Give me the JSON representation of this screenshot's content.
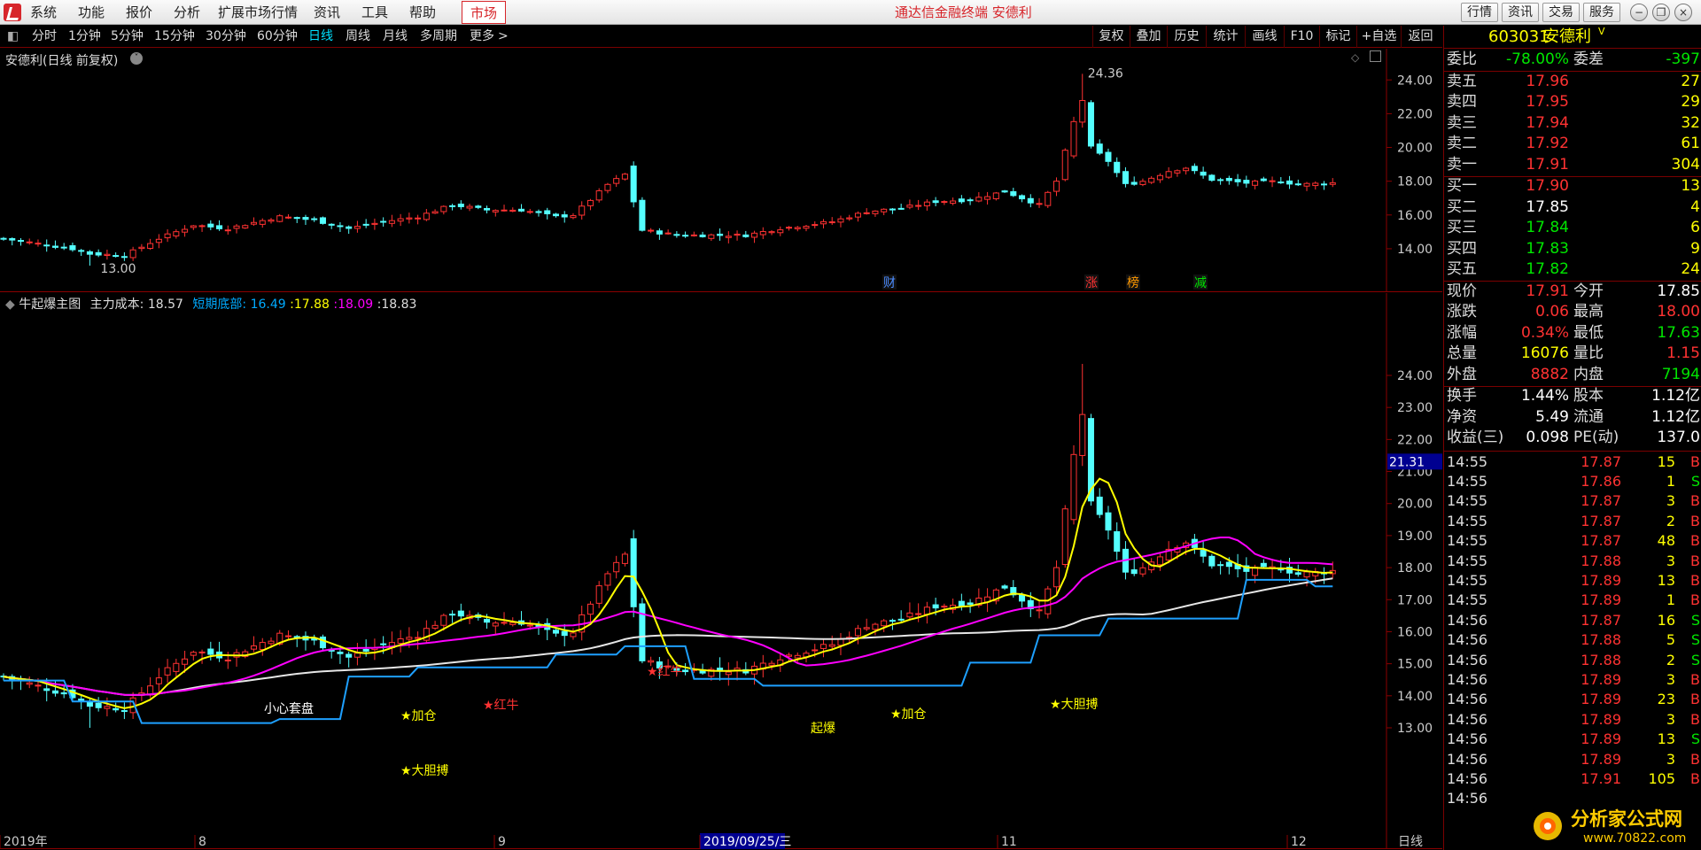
{
  "menu": {
    "items": [
      "系统",
      "功能",
      "报价",
      "分析",
      "扩展市场行情",
      "资讯",
      "工具",
      "帮助"
    ],
    "market_tab": "市场",
    "app_title": "通达信金融终端  安德利",
    "right_buttons": [
      "行情",
      "资讯",
      "交易",
      "服务"
    ]
  },
  "toolbar": {
    "periods": [
      "分时",
      "1分钟",
      "5分钟",
      "15分钟",
      "30分钟",
      "60分钟",
      "日线",
      "周线",
      "月线",
      "多周期",
      "更多"
    ],
    "active_period": "日线",
    "more_arrow": ">",
    "right": [
      "复权",
      "叠加",
      "历史",
      "统计",
      "画线",
      "F10",
      "标记",
      "+自选",
      "返回"
    ]
  },
  "top_chart": {
    "title": "安德利(日线 前复权)",
    "high_label": "24.36",
    "low_label": "13.00",
    "y_ticks": [
      "24.00",
      "22.00",
      "20.00",
      "18.00",
      "16.00",
      "14.00"
    ],
    "events": [
      {
        "label": "财",
        "color": "#4c8cff"
      },
      {
        "label": "涨",
        "color": "#ff3232"
      },
      {
        "label": "榜",
        "color": "#ff9900"
      },
      {
        "label": "减",
        "color": "#00e600"
      }
    ]
  },
  "main_chart": {
    "indicator": "牛起爆主图",
    "cost_label": "主力成本:",
    "cost_value": "18.57",
    "bottom_label": "短期底部:",
    "v1": "16.49",
    "v2": "17.88",
    "v3": "18.09",
    "v4": "18.83",
    "y_ticks": [
      "24.00",
      "23.00",
      "22.00",
      "21.00",
      "20.00",
      "19.00",
      "18.00",
      "17.00",
      "16.00",
      "15.00",
      "14.00",
      "13.00"
    ],
    "cursor_price": "21.31",
    "annotations": [
      "小心套盘",
      "★加仓",
      "★红牛",
      "★红牛",
      "★大胆搏",
      "★加仓",
      "★大胆搏",
      "起爆"
    ],
    "x_labels": [
      "2019年",
      "8",
      "9",
      "2019/09/25/三",
      "11",
      "12"
    ],
    "period_label": "日线"
  },
  "panel": {
    "code": "603031",
    "name": "安德利",
    "badge": "V",
    "weibi": {
      "l": "委比",
      "v": "-78.00%",
      "l2": "委差",
      "v2": "-397"
    },
    "sells": [
      {
        "l": "卖五",
        "p": "17.96",
        "v": "27"
      },
      {
        "l": "卖四",
        "p": "17.95",
        "v": "29"
      },
      {
        "l": "卖三",
        "p": "17.94",
        "v": "32"
      },
      {
        "l": "卖二",
        "p": "17.92",
        "v": "61"
      },
      {
        "l": "卖一",
        "p": "17.91",
        "v": "304"
      }
    ],
    "buys": [
      {
        "l": "买一",
        "p": "17.90",
        "v": "13"
      },
      {
        "l": "买二",
        "p": "17.85",
        "v": "4"
      },
      {
        "l": "买三",
        "p": "17.84",
        "v": "6"
      },
      {
        "l": "买四",
        "p": "17.83",
        "v": "9"
      },
      {
        "l": "买五",
        "p": "17.82",
        "v": "24"
      }
    ],
    "stats": [
      {
        "l": "现价",
        "v": "17.91",
        "l2": "今开",
        "v2": "17.85"
      },
      {
        "l": "涨跌",
        "v": "0.06",
        "l2": "最高",
        "v2": "18.00"
      },
      {
        "l": "涨幅",
        "v": "0.34%",
        "l2": "最低",
        "v2": "17.63"
      },
      {
        "l": "总量",
        "v": "16076",
        "l2": "量比",
        "v2": "1.15"
      },
      {
        "l": "外盘",
        "v": "8882",
        "l2": "内盘",
        "v2": "7194"
      }
    ],
    "fund": [
      {
        "l": "换手",
        "v": "1.44%",
        "l2": "股本",
        "v2": "1.12亿"
      },
      {
        "l": "净资",
        "v": "5.49",
        "l2": "流通",
        "v2": "1.12亿"
      },
      {
        "l": "收益(三)",
        "v": "0.098",
        "l2": "PE(动)",
        "v2": "137.0"
      }
    ],
    "ticks": [
      [
        "14:55",
        "17.87",
        "15",
        "B"
      ],
      [
        "14:55",
        "17.86",
        "1",
        "S"
      ],
      [
        "14:55",
        "17.87",
        "3",
        "B"
      ],
      [
        "14:55",
        "17.87",
        "2",
        "B"
      ],
      [
        "14:55",
        "17.87",
        "48",
        "B"
      ],
      [
        "14:55",
        "17.88",
        "3",
        "B"
      ],
      [
        "14:55",
        "17.89",
        "13",
        "B"
      ],
      [
        "14:55",
        "17.89",
        "1",
        "B"
      ],
      [
        "14:56",
        "17.87",
        "16",
        "S"
      ],
      [
        "14:56",
        "17.88",
        "5",
        "S"
      ],
      [
        "14:56",
        "17.88",
        "2",
        "S"
      ],
      [
        "14:56",
        "17.89",
        "3",
        "B"
      ],
      [
        "14:56",
        "17.89",
        "23",
        "B"
      ],
      [
        "14:56",
        "17.89",
        "3",
        "B"
      ],
      [
        "14:56",
        "17.89",
        "13",
        "S"
      ],
      [
        "14:56",
        "17.89",
        "3",
        "B"
      ],
      [
        "14:56",
        "17.91",
        "105",
        "B"
      ],
      [
        "14:56",
        "",
        "",
        " "
      ]
    ]
  },
  "watermark": {
    "text": "分析家公式网",
    "url": "www.70822.com"
  }
}
